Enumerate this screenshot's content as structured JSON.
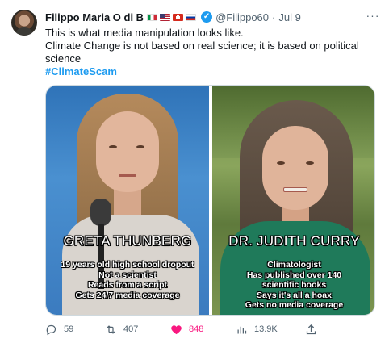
{
  "tweet": {
    "author_name": "Filippo Maria O di B",
    "handle": "@Filippo60",
    "separator": "·",
    "time": "Jul 9",
    "more_label": "···",
    "text_lines": [
      "This is what media manipulation looks like.",
      "Climate Change is not based on real science; it is based on political science"
    ],
    "hashtag": "#ClimateScam",
    "verified_glyph": "✓"
  },
  "image": {
    "left": {
      "name": "GRETA THUNBERG",
      "lines": [
        "19 years old high school dropout",
        "Not a scientist",
        "Reads from a script",
        "Gets 24/7 media coverage"
      ]
    },
    "right": {
      "name": "DR. JUDITH CURRY",
      "lines": [
        "Climatologist",
        "Has published over 140",
        "scientific books",
        "Says it's all a hoax",
        "Gets no media coverage"
      ]
    }
  },
  "actions": {
    "replies": "59",
    "retweets": "407",
    "likes": "848",
    "views": "13.9K"
  },
  "colors": {
    "accent": "#1d9bf0",
    "like": "#f91880",
    "muted": "#536471"
  }
}
